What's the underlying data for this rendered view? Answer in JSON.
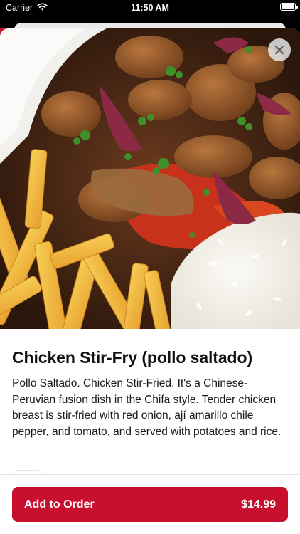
{
  "status_bar": {
    "carrier": "Carrier",
    "time": "11:50 AM"
  },
  "item": {
    "title": "Chicken Stir-Fry (pollo saltado)",
    "description": "Pollo Saltado.  Chicken Stir-Fried. It's a Chinese-Peruvian fusion dish in the Chifa style. Tender chicken breast is stir-fried with red onion, ají amarillo chile pepper, and tomato, and served with potatoes and rice."
  },
  "footer": {
    "add_label": "Add to Order",
    "price": "$14.99"
  },
  "colors": {
    "accent": "#c8102e"
  },
  "icons": {
    "close": "close-icon",
    "wifi": "wifi-icon",
    "battery": "battery-icon"
  }
}
